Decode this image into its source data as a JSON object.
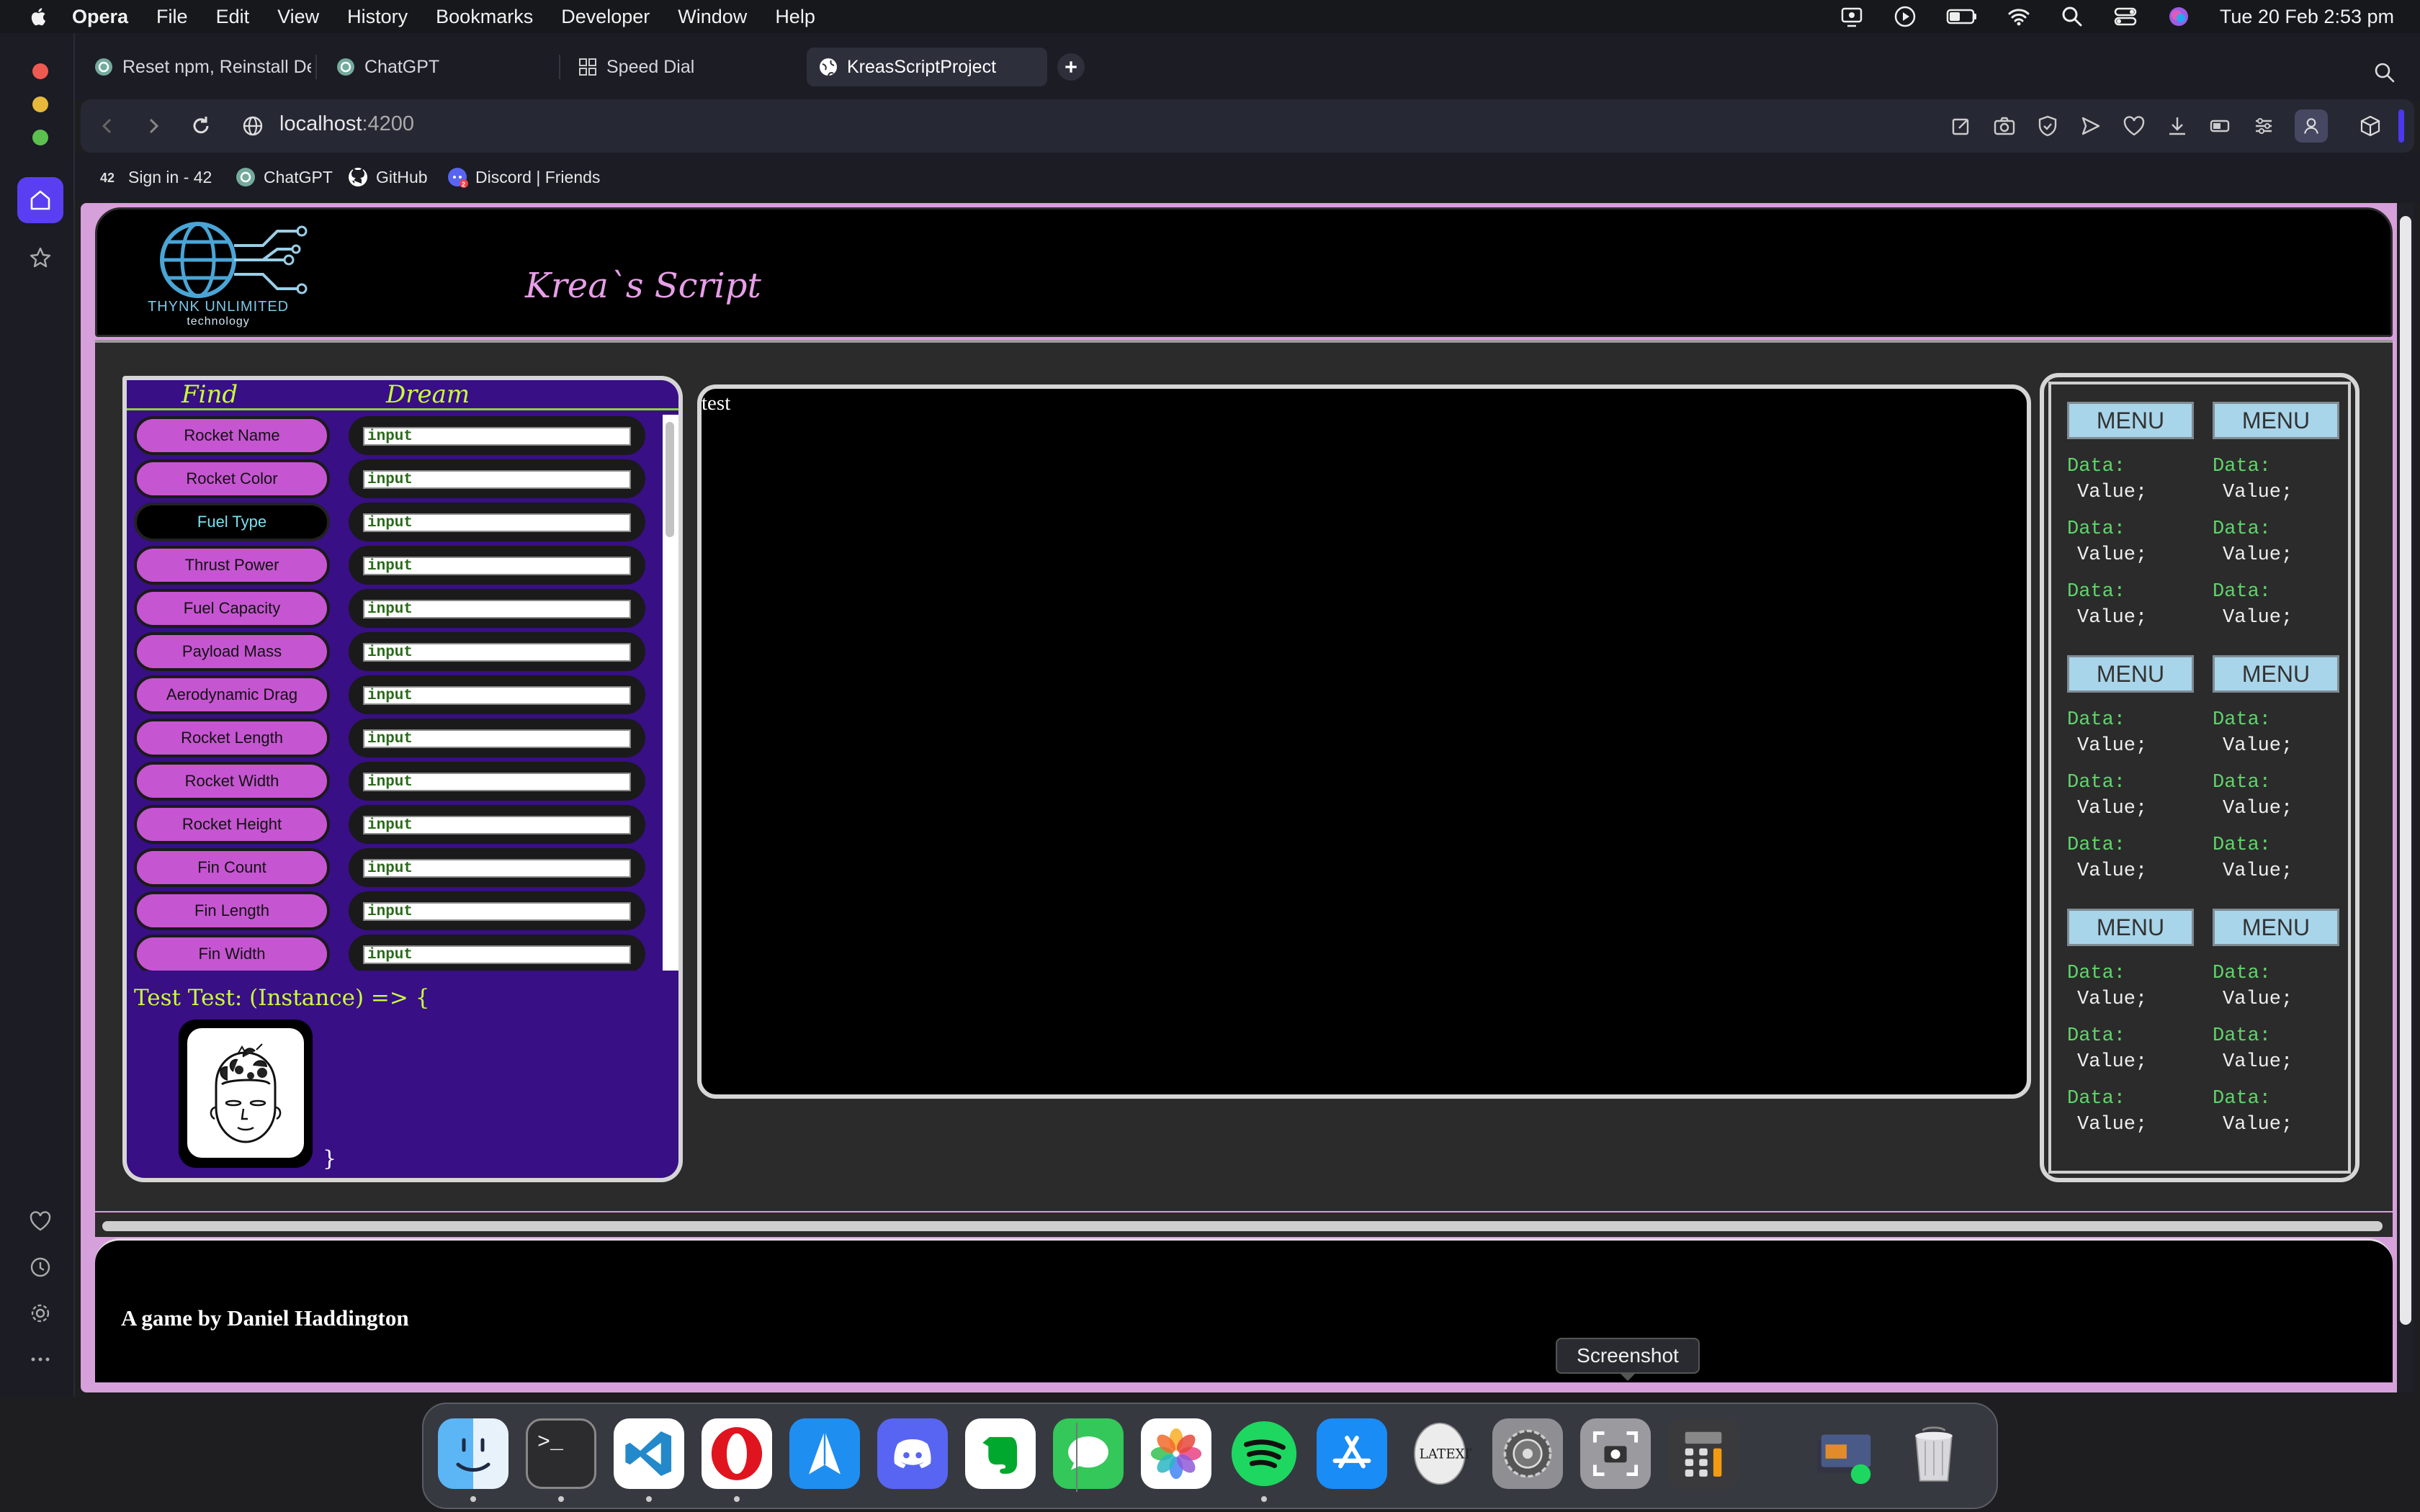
{
  "menubar": {
    "app": "Opera",
    "items": [
      "File",
      "Edit",
      "View",
      "History",
      "Bookmarks",
      "Developer",
      "Window",
      "Help"
    ],
    "clock": "Tue 20 Feb  2:53 pm"
  },
  "tabs": [
    {
      "title": "Reset npm, Reinstall Dep",
      "icon": "chatgpt-icon"
    },
    {
      "title": "ChatGPT",
      "icon": "chatgpt-icon"
    },
    {
      "title": "Speed Dial",
      "icon": "speed-dial-icon"
    },
    {
      "title": "KreasScriptProject",
      "icon": "globe-icon",
      "active": true
    }
  ],
  "address": {
    "host": "localhost",
    "port": ":4200"
  },
  "bookmarks": [
    {
      "label": "Sign in - 42",
      "icon": "42-icon"
    },
    {
      "label": "ChatGPT",
      "icon": "chatgpt-icon"
    },
    {
      "label": "GitHub",
      "icon": "github-icon"
    },
    {
      "label": "Discord | Friends",
      "icon": "discord-icon"
    }
  ],
  "site": {
    "logo_line1": "THYNK UNLIMITED",
    "logo_line2": "technology",
    "title": "Krea`s Script"
  },
  "left_panel": {
    "find_label": "Find",
    "dream_label": "Dream",
    "rows": [
      {
        "label": "Rocket Name",
        "value": "input"
      },
      {
        "label": "Rocket Color",
        "value": "input"
      },
      {
        "label": "Fuel Type",
        "value": "input",
        "selected": true
      },
      {
        "label": "Thrust Power",
        "value": "input"
      },
      {
        "label": "Fuel Capacity",
        "value": "input"
      },
      {
        "label": "Payload Mass",
        "value": "input"
      },
      {
        "label": "Aerodynamic Drag",
        "value": "input"
      },
      {
        "label": "Rocket Length",
        "value": "input"
      },
      {
        "label": "Rocket Width",
        "value": "input"
      },
      {
        "label": "Rocket Height",
        "value": "input"
      },
      {
        "label": "Fin Count",
        "value": "input"
      },
      {
        "label": "Fin Length",
        "value": "input"
      },
      {
        "label": "Fin Width",
        "value": "input"
      }
    ],
    "test_line": "Test Test: (Instance) => {",
    "close_brace": "}"
  },
  "canvas": {
    "text": "test"
  },
  "right_panel": {
    "groups": [
      {
        "menus": [
          "MENU",
          "MENU"
        ],
        "pairs": [
          [
            "Data:",
            "Value;"
          ],
          [
            "Data:",
            "Value;"
          ],
          [
            "Data:",
            "Value;"
          ]
        ]
      },
      {
        "menus": [
          "MENU",
          "MENU"
        ],
        "pairs": [
          [
            "Data:",
            "Value;"
          ],
          [
            "Data:",
            "Value;"
          ],
          [
            "Data:",
            "Value;"
          ]
        ]
      },
      {
        "menus": [
          "MENU",
          "MENU"
        ],
        "pairs": [
          [
            "Data:",
            "Value;"
          ],
          [
            "Data:",
            "Value;"
          ],
          [
            "Data:",
            "Value;"
          ]
        ]
      }
    ]
  },
  "footer": {
    "credit": "A game by Daniel Haddington"
  },
  "tooltip": "Screenshot",
  "dock": {
    "apps": [
      "finder-icon",
      "terminal-icon",
      "vscode-icon",
      "opera-icon",
      "testflight-icon",
      "discord-icon",
      "evernote-icon",
      "messages-icon",
      "photos-icon",
      "spotify-icon",
      "app-store-icon",
      "latexit-icon",
      "system-settings-icon",
      "screenshot-icon",
      "calculator-icon",
      "downloads-stack-icon",
      "trash-icon"
    ]
  },
  "colors": {
    "page_bg": "#d6a0da",
    "find_button": "#c655d2",
    "left_panel_bg": "#380f85",
    "headline_green": "#c8ff3a",
    "data_green": "#5fd46a",
    "menu_button": "#a9d5ea"
  }
}
